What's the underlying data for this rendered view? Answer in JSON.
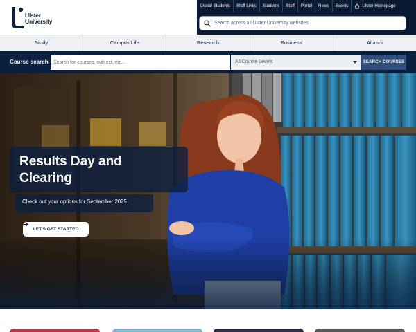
{
  "brand": {
    "name_line1": "Ulster",
    "name_line2": "University",
    "accent": "#0b1f3f",
    "topbar_color": "#0b1a33"
  },
  "toplinks": [
    "Global Students",
    "Staff Links",
    "Students",
    "Staff",
    "Portal",
    "News",
    "Events"
  ],
  "home_link": {
    "label": "Ulster Homepage",
    "icon": "home-icon"
  },
  "site_search": {
    "placeholder": "Search across all Ulster University websites",
    "icon": "search-icon"
  },
  "nav": [
    "Study",
    "Campus Life",
    "Research",
    "Business",
    "Alumni"
  ],
  "course_search": {
    "label": "Course search",
    "placeholder": "Search for courses, subject, etc...",
    "levels_value": "All Course Levels",
    "button": "SEARCH COURSES"
  },
  "hero": {
    "title_line1": "Results Day and",
    "title_line2": "Clearing",
    "subtitle": "Check out your options for September 2025.",
    "cta": "LET'S GET STARTED",
    "cta_icon": "arrow-right-icon"
  }
}
